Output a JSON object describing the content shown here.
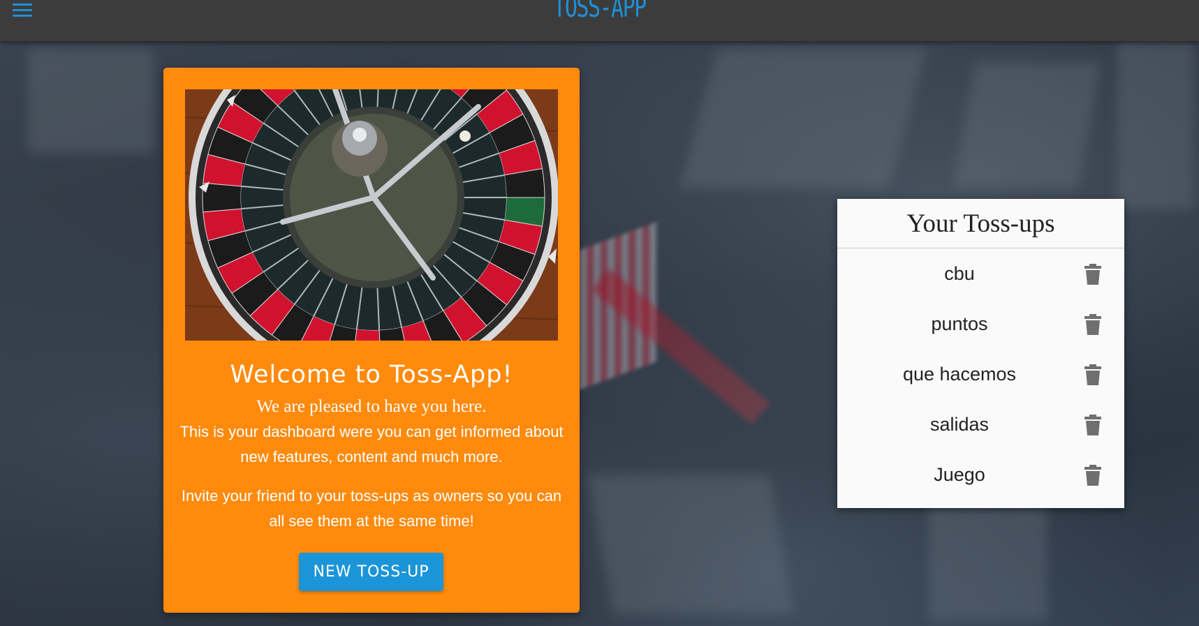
{
  "header": {
    "app_title": "TOSS-APP",
    "menu_icon": "hamburger-menu-icon"
  },
  "welcome": {
    "image_alt": "roulette-wheel",
    "title": "Welcome to Toss-App!",
    "subtitle": "We are pleased to have you here.",
    "text1": "This is your dashboard were you can get informed about new features, content and much more.",
    "text2": "Invite your friend to your toss-ups as owners so you can all see them at the same time!",
    "new_button": "NEW TOSS-UP"
  },
  "tossups": {
    "title": "Your Toss-ups",
    "delete_icon": "trash-icon",
    "items": [
      {
        "label": "cbu"
      },
      {
        "label": "puntos"
      },
      {
        "label": "que hacemos"
      },
      {
        "label": "salidas"
      },
      {
        "label": "Juego"
      }
    ]
  },
  "colors": {
    "topbar": "#3c3c3c",
    "accent_blue": "#1b95d8",
    "card_orange": "#ff8a0c",
    "panel_bg": "#fafafa"
  }
}
